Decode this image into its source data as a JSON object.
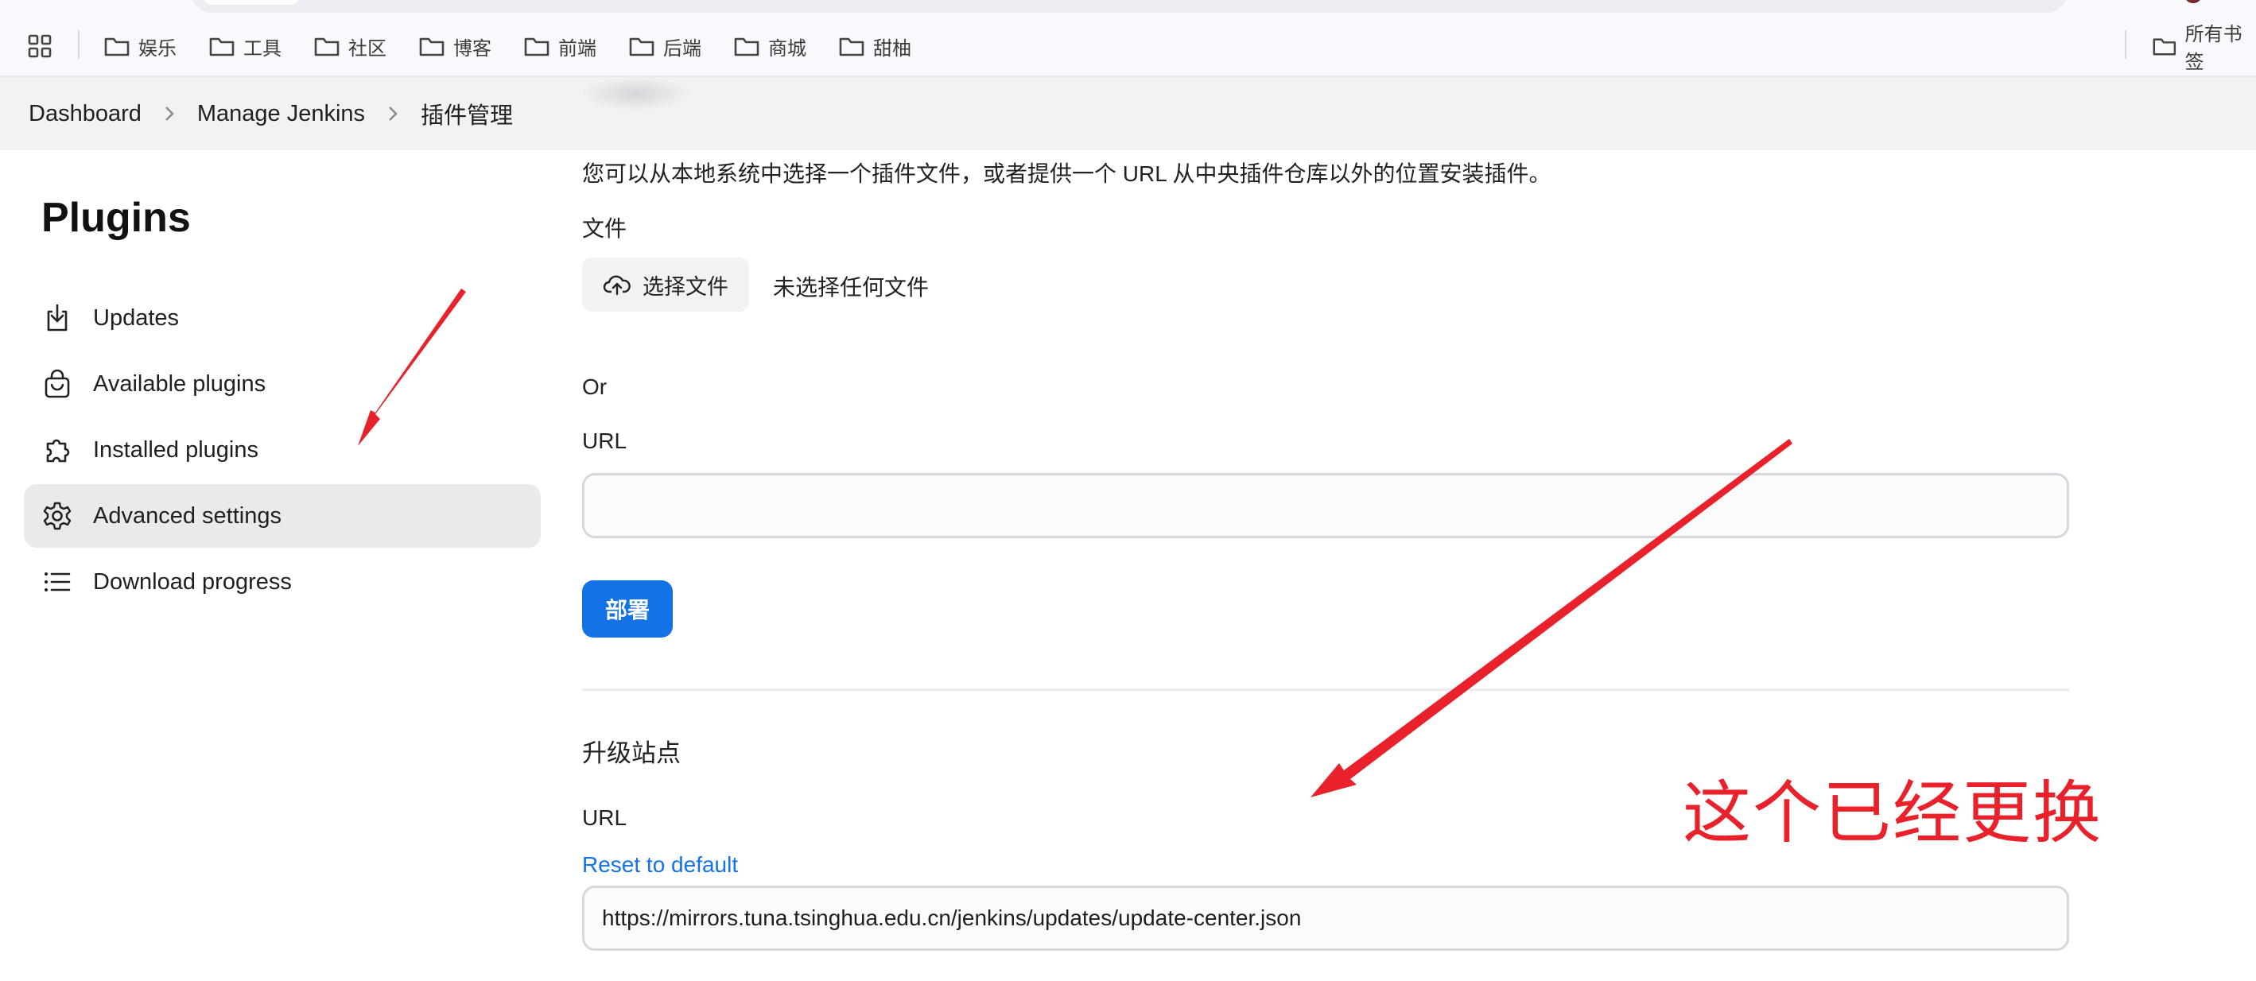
{
  "bookmarks": {
    "items": [
      {
        "label": "娱乐"
      },
      {
        "label": "工具"
      },
      {
        "label": "社区"
      },
      {
        "label": "博客"
      },
      {
        "label": "前端"
      },
      {
        "label": "后端"
      },
      {
        "label": "商城"
      },
      {
        "label": "甜柚"
      }
    ],
    "all_bookmarks_label": "所有书签"
  },
  "breadcrumb": {
    "items": [
      "Dashboard",
      "Manage Jenkins",
      "插件管理"
    ]
  },
  "sidebar": {
    "title": "Plugins",
    "items": [
      {
        "label": "Updates",
        "icon": "download-icon"
      },
      {
        "label": "Available plugins",
        "icon": "shopping-bag-icon"
      },
      {
        "label": "Installed plugins",
        "icon": "puzzle-icon"
      },
      {
        "label": "Advanced settings",
        "icon": "gear-icon",
        "active": true
      },
      {
        "label": "Download progress",
        "icon": "list-icon"
      }
    ]
  },
  "deploy_plugin": {
    "description": "您可以从本地系统中选择一个插件文件，或者提供一个 URL 从中央插件仓库以外的位置安装插件。",
    "file_label": "文件",
    "choose_file_button": "选择文件",
    "no_file_text": "未选择任何文件",
    "or_label": "Or",
    "url_label": "URL",
    "url_value": "",
    "deploy_button": "部署"
  },
  "update_site": {
    "title": "升级站点",
    "url_label": "URL",
    "reset_link": "Reset to default",
    "url_value": "https://mirrors.tuna.tsinghua.edu.cn/jenkins/updates/update-center.json"
  },
  "annotation": {
    "text": "这个已经更换",
    "color": "#e8212b"
  },
  "colors": {
    "accent": "#1272e6",
    "active_nav_bg": "#eaeaed",
    "header_bg": "#f2f2f4"
  }
}
